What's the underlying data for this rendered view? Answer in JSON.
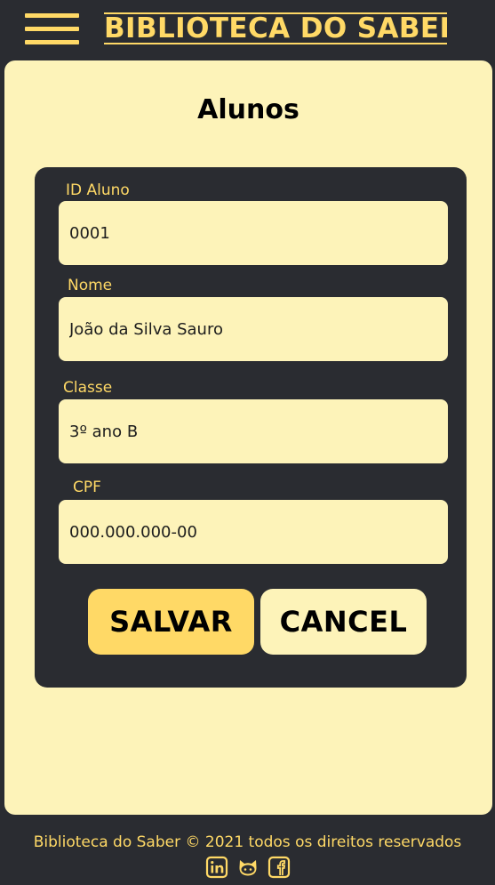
{
  "header": {
    "brand": "BIBLIOTECA DO SABER",
    "menu_icon": "hamburger-menu-icon"
  },
  "main": {
    "title": "Alunos",
    "fields": [
      {
        "label": "ID Aluno",
        "value": "0001"
      },
      {
        "label": "Nome",
        "value": "João da Silva Sauro"
      },
      {
        "label": "Classe",
        "value": "3º ano B"
      },
      {
        "label": "CPF",
        "value": "000.000.000-00"
      }
    ],
    "save_label": "SALVAR",
    "cancel_label": "CANCEL"
  },
  "footer": {
    "text": "Biblioteca do Saber © 2021 todos os direitos reservados",
    "socials": [
      "linkedin-icon",
      "github-icon",
      "facebook-icon"
    ]
  },
  "colors": {
    "background": "#2a2c31",
    "accent": "#ffd966",
    "card": "#fdf3b9"
  }
}
